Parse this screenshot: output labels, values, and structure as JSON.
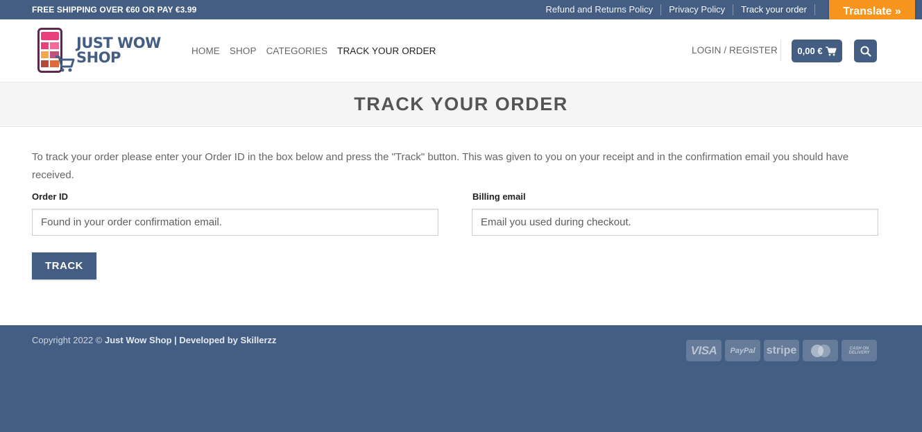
{
  "topbar": {
    "promo": "FREE SHIPPING OVER €60 OR PAY €3.99",
    "links": [
      "Refund and Returns Policy",
      "Privacy Policy",
      "Track your order"
    ],
    "translate": "Translate »"
  },
  "header": {
    "brand_line1": "JUST WOW",
    "brand_line2": "SHOP",
    "nav": [
      "HOME",
      "SHOP",
      "CATEGORIES",
      "TRACK YOUR ORDER"
    ],
    "login": "LOGIN / REGISTER",
    "cart_total": "0,00 €"
  },
  "page": {
    "title": "TRACK YOUR ORDER",
    "intro": "To track your order please enter your Order ID in the box below and press the \"Track\" button. This was given to you on your receipt and in the confirmation email you should have received.",
    "order_id_label": "Order ID",
    "order_id_placeholder": "Found in your order confirmation email.",
    "order_id_value": "",
    "email_label": "Billing email",
    "email_placeholder": "Email you used during checkout.",
    "email_value": "",
    "track_button": "TRACK"
  },
  "footer": {
    "copyright_prefix": "Copyright 2022 © ",
    "copyright_brand": "Just Wow Shop | Developed by Skillerzz",
    "payments": [
      "VISA",
      "PayPal",
      "stripe",
      "MasterCard",
      "CASH ON DELIVERY"
    ]
  },
  "colors": {
    "primary": "#445e83",
    "translate": "#f7941e"
  }
}
